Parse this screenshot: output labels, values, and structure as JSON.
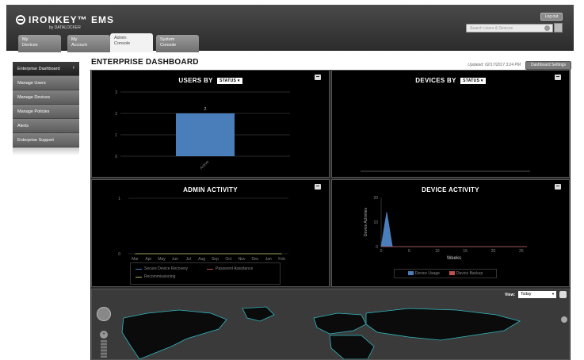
{
  "header": {
    "logo": "IRONKEY™ EMS",
    "logo_sub": "by DATALOCKER",
    "logout": "Log out",
    "search_placeholder": "Search Users & Devices",
    "tabs": [
      {
        "line1": "My",
        "line2": "Devices"
      },
      {
        "line1": "My",
        "line2": "Account"
      },
      {
        "line1": "Admin",
        "line2": "Console"
      },
      {
        "line1": "System",
        "line2": "Console"
      }
    ]
  },
  "sidebar": {
    "items": [
      {
        "label": "Enterprise Dashboard"
      },
      {
        "label": "Manage Users"
      },
      {
        "label": "Manage Devices"
      },
      {
        "label": "Manage Policies"
      },
      {
        "label": "Alerts"
      },
      {
        "label": "Enterprise Support"
      }
    ]
  },
  "main": {
    "title": "ENTERPRISE DASHBOARD",
    "updated": "Updated: 02/17/2017 3:24 PM",
    "settings_button": "Dashboard Settings"
  },
  "panels": {
    "users": {
      "title": "USERS BY",
      "select": "STATUS"
    },
    "devices": {
      "title": "DEVICES BY",
      "select": "STATUS"
    },
    "admin": {
      "title": "ADMIN ACTIVITY"
    },
    "device_activity": {
      "title": "DEVICE ACTIVITY"
    },
    "map": {
      "view_label": "View:",
      "view_value": "Today"
    }
  },
  "colors": {
    "bar_blue": "#4a7ebb",
    "legend_red": "#c0504d",
    "map_outline": "#2fb8c0"
  },
  "chart_data": [
    {
      "type": "bar",
      "categories": [
        "Active"
      ],
      "values": [
        2
      ],
      "data_labels": [
        "2"
      ],
      "yticks": [
        "0",
        "1",
        "2",
        "3"
      ],
      "ylim": [
        0,
        3
      ]
    },
    {
      "type": "line",
      "x": [
        "Mar",
        "Apr",
        "May",
        "Jun",
        "Jul",
        "Aug",
        "Sep",
        "Oct",
        "Nov",
        "Dec",
        "Jan",
        "Feb"
      ],
      "yticks": [
        "0",
        "1"
      ],
      "ylim": [
        0,
        1
      ],
      "series": [
        {
          "name": "Secure Device Recovery",
          "color": "#4a7ebb",
          "values": [
            0,
            0,
            0,
            0,
            0,
            0,
            0,
            0,
            0,
            0,
            0,
            0
          ]
        },
        {
          "name": "Password Assistance",
          "color": "#c0504d",
          "values": [
            0,
            0,
            0,
            0,
            0,
            0,
            0,
            0,
            0,
            0,
            0,
            0
          ]
        },
        {
          "name": "Recommissioning",
          "color": "#9bbb59",
          "values": [
            0,
            0,
            0,
            0,
            0,
            0,
            0,
            0,
            0,
            0,
            0,
            0
          ]
        }
      ]
    },
    {
      "type": "area",
      "xlabel": "Weeks",
      "ylabel": "Device Activities",
      "xticks": [
        0,
        5,
        10,
        15,
        20,
        25
      ],
      "yticks": [
        0,
        10,
        20
      ],
      "ylim": [
        0,
        20
      ],
      "series": [
        {
          "name": "Device Usage",
          "color": "#4a7ebb",
          "points": [
            [
              0,
              0
            ],
            [
              1,
              14
            ],
            [
              2,
              0
            ],
            [
              26,
              0
            ]
          ]
        },
        {
          "name": "Device Backup",
          "color": "#c0504d",
          "points": [
            [
              0,
              0
            ],
            [
              26,
              0
            ]
          ]
        }
      ]
    }
  ]
}
